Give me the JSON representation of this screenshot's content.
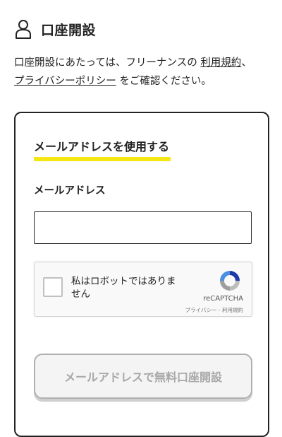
{
  "header": {
    "title": "口座開設",
    "icon": "person-icon"
  },
  "intro": {
    "text_1": "口座開設にあたっては、フリーナンスの ",
    "terms_link": "利用規約",
    "text_2": "、",
    "privacy_link": "プライバシーポリシー",
    "text_3": " をご確認ください。"
  },
  "form": {
    "section_title": "メールアドレスを使用する",
    "email_label": "メールアドレス",
    "email_value": "",
    "email_placeholder": "",
    "recaptcha": {
      "label": "私はロボットではありません",
      "brand": "reCAPTCHA",
      "terms": "プライバシー - 利用規約"
    },
    "submit_label": "メールアドレスで無料口座開設"
  },
  "colors": {
    "accent_underline": "#f5e714",
    "border": "#222222",
    "disabled_text": "#a8a8a8"
  }
}
